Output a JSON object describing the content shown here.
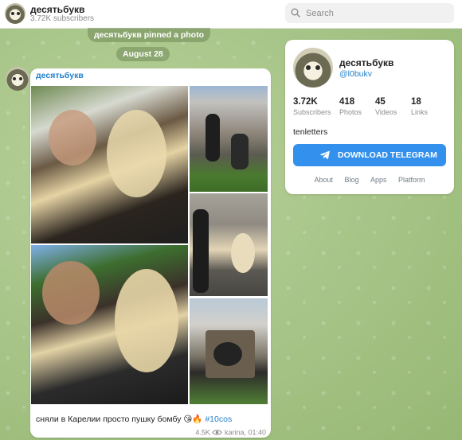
{
  "channel": {
    "name": "десятьбукв",
    "subscribers_short": "3.72K subscribers",
    "username": "@l0bukv",
    "description": "tenletters"
  },
  "search": {
    "placeholder": "Search"
  },
  "service": {
    "pinned": "десятьбукв pinned a photo",
    "date": "August 28"
  },
  "message": {
    "author": "десятьбукв",
    "caption_text": "сняли в Карелии просто пушку бомбу 😘🔥 ",
    "hashtag": "#10cos",
    "views": "4.5K",
    "signature_time": "karina, 01:40",
    "photo_count": 5
  },
  "stats": [
    {
      "value": "3.72K",
      "label": "Subscribers"
    },
    {
      "value": "418",
      "label": "Photos"
    },
    {
      "value": "45",
      "label": "Videos"
    },
    {
      "value": "18",
      "label": "Links"
    }
  ],
  "download_button": "DOWNLOAD TELEGRAM",
  "footer_links": [
    "About",
    "Blog",
    "Apps",
    "Platform"
  ],
  "colors": {
    "accent": "#3390ec",
    "link": "#2481cc"
  }
}
